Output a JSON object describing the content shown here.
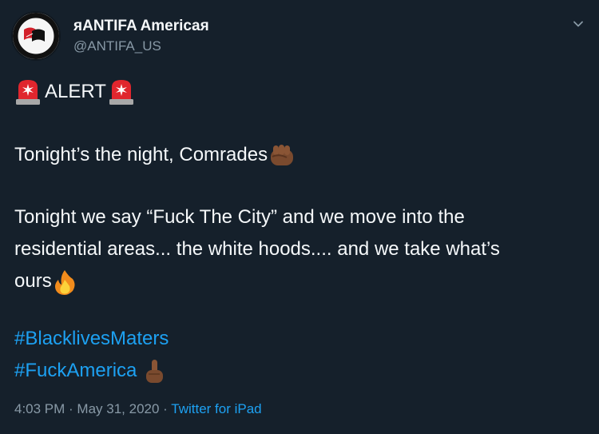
{
  "tweet": {
    "display_name_prefix": "ᴙ",
    "display_name": "ANTIFA America",
    "display_name_suffix": "ᴙ",
    "handle": "@ANTIFA_US",
    "alert_label": "ALERT",
    "line1": "Tonight’s the night, Comrades",
    "line2": "Tonight we say “Fuck The City” and we move into the",
    "line3": "residential areas... the white hoods.... and we take what’s",
    "line4": "ours",
    "hashtag1": "#BlacklivesMaters",
    "hashtag2": "#FuckAmerica",
    "time": "4:03 PM",
    "separator": " · ",
    "date": "May 31, 2020",
    "source": "Twitter for iPad"
  },
  "icons": {
    "avatar": "antifa-flag-logo-icon",
    "menu": "chevron-down-icon",
    "alert": "rotating-light-siren-icon",
    "line1": "raised-fist-icon",
    "line4": "fire-icon",
    "hashtag2": "middle-finger-icon"
  },
  "colors": {
    "background": "#15202b",
    "text": "#f5f8fa",
    "secondary": "#8899a6",
    "link": "#1da1f2"
  }
}
